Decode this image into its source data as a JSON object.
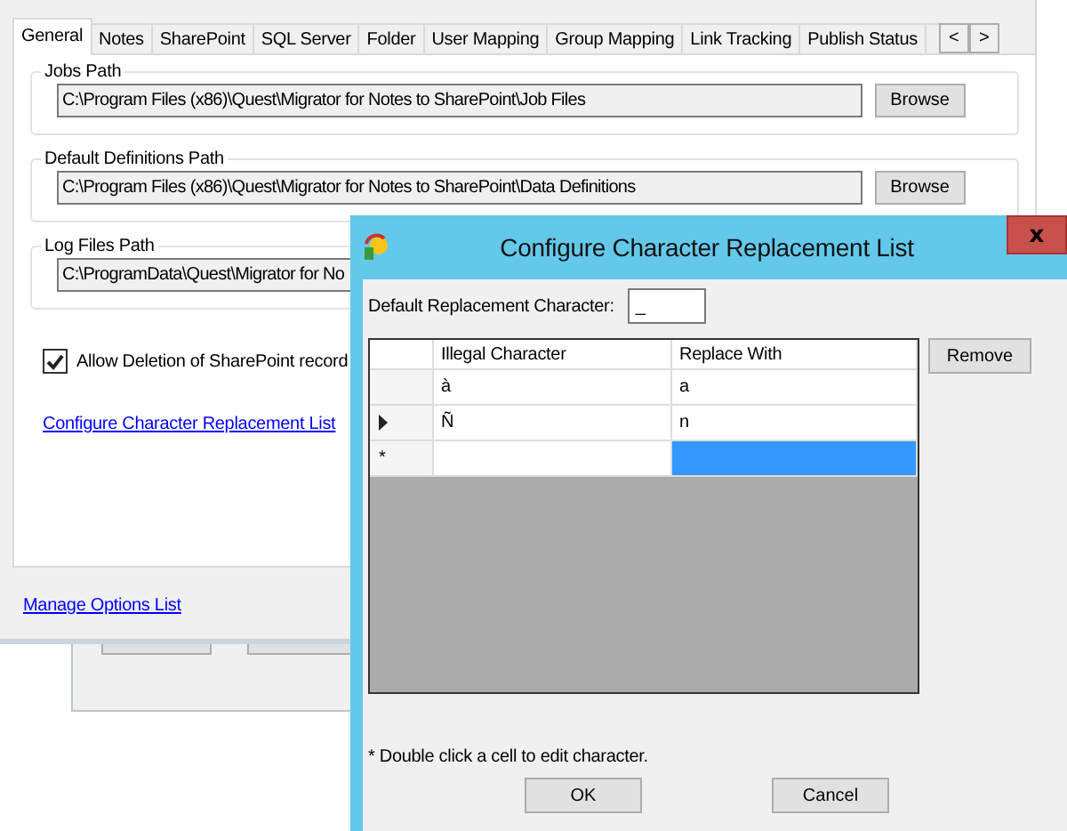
{
  "main_window": {
    "tabs": [
      {
        "label": "General",
        "selected": true
      },
      {
        "label": "Notes",
        "selected": false
      },
      {
        "label": "SharePoint",
        "selected": false
      },
      {
        "label": "SQL Server",
        "selected": false
      },
      {
        "label": "Folder",
        "selected": false
      },
      {
        "label": "User Mapping",
        "selected": false
      },
      {
        "label": "Group Mapping",
        "selected": false
      },
      {
        "label": "Link Tracking",
        "selected": false
      },
      {
        "label": "Publish Status",
        "selected": false
      }
    ],
    "tab_scroll": [
      "<",
      ">"
    ],
    "path_groups": [
      {
        "label": "Jobs Path",
        "value": "C:\\Program Files (x86)\\Quest\\Migrator for Notes to SharePoint\\Job Files",
        "button": "Browse"
      },
      {
        "label": "Default Definitions Path",
        "value": "C:\\Program Files (x86)\\Quest\\Migrator for Notes to SharePoint\\Data Definitions",
        "button": "Browse"
      },
      {
        "label": "Log Files Path",
        "value": "C:\\ProgramData\\Quest\\Migrator for No"
      }
    ],
    "allow_deletion": {
      "label": "Allow Deletion of SharePoint record",
      "checked": true
    },
    "configure_link": "Configure Character Replacement List",
    "manage_link": "Manage Options List"
  },
  "dialog": {
    "title": "Configure Character Replacement List",
    "close": "x",
    "default_label": "Default Replacement Character:",
    "default_value": "_",
    "columns": [
      "Illegal Character",
      "Replace With"
    ],
    "rows": [
      {
        "kind": "data",
        "current": false,
        "cells": [
          {
            "text": "à",
            "selected": false
          },
          {
            "text": "a",
            "selected": false
          }
        ]
      },
      {
        "kind": "data",
        "current": true,
        "cells": [
          {
            "text": "Ñ",
            "selected": false
          },
          {
            "text": "n",
            "selected": false
          }
        ]
      },
      {
        "kind": "new",
        "marker": "*",
        "current": false,
        "cells": [
          {
            "selected": false
          },
          {
            "selected": true
          }
        ]
      }
    ],
    "remove_button": "Remove",
    "note": "* Double click a cell to edit character.",
    "buttons": [
      "OK",
      "Cancel"
    ]
  }
}
